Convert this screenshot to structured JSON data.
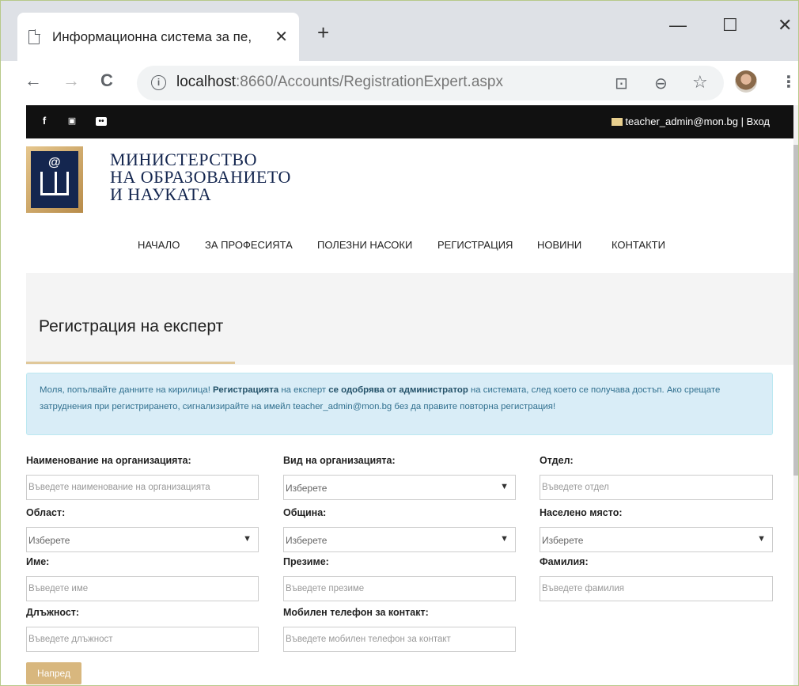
{
  "browser": {
    "tab_title": "Информационна система за пе,",
    "tab_close": "✕",
    "new_tab": "+",
    "url_host": "localhost",
    "url_rest": ":8660/Accounts/RegistrationExpert.aspx",
    "minimize": "—",
    "maximize": "☐",
    "close": "✕",
    "back": "←",
    "forward": "→",
    "reload": "C",
    "info": "i",
    "translate": "⊡",
    "zoom": "⊖",
    "star": "☆",
    "menu": "⋮"
  },
  "topbar": {
    "social": [
      "f",
      "▣",
      "••"
    ],
    "email": "teacher_admin@mon.bg",
    "separator": " | ",
    "login": "Вход"
  },
  "logo": {
    "at": "@",
    "line1": "МИНИСТЕРСТВО",
    "line2": "НА ОБРАЗОВАНИЕТО",
    "line3": "И НАУКАТА"
  },
  "nav": {
    "items": [
      "НАЧАЛО",
      "ЗА ПРОФЕСИЯТА",
      "ПОЛЕЗНИ НАСОКИ",
      "РЕГИСТРАЦИЯ",
      "НОВИНИ",
      "КОНТАКТИ"
    ]
  },
  "page": {
    "title": "Регистрация на експерт"
  },
  "alert": {
    "p1": "Моля, попълвайте данните на кирилица! ",
    "b1": "Регистрацията",
    "p2": " на експерт ",
    "b2": "се одобрява от администратор",
    "p3": " на системата, след което се получава достъп. Ако срещате затруднения при регистрирането, сигнализирайте на имейл teacher_admin@mon.bg без да правите повторна регистрация!"
  },
  "form": {
    "org_name_label": "Наименование на организацията:",
    "org_name_placeholder": "Въведете наименование на организацията",
    "org_type_label": "Вид на организацията:",
    "org_type_value": "Изберете",
    "department_label": "Отдел:",
    "department_placeholder": "Въведете отдел",
    "region_label": "Област:",
    "region_value": "Изберете",
    "municipality_label": "Община:",
    "municipality_value": "Изберете",
    "settlement_label": "Населено място:",
    "settlement_value": "Изберете",
    "first_name_label": "Име:",
    "first_name_placeholder": "Въведете име",
    "middle_name_label": "Презиме:",
    "middle_name_placeholder": "Въведете презиме",
    "last_name_label": "Фамилия:",
    "last_name_placeholder": "Въведете фамилия",
    "position_label": "Длъжност:",
    "position_placeholder": "Въведете длъжност",
    "phone_label": "Мобилен телефон за контакт:",
    "phone_placeholder": "Въведете мобилен телефон за контакт",
    "caret": "▼",
    "next_button": "Напред"
  }
}
